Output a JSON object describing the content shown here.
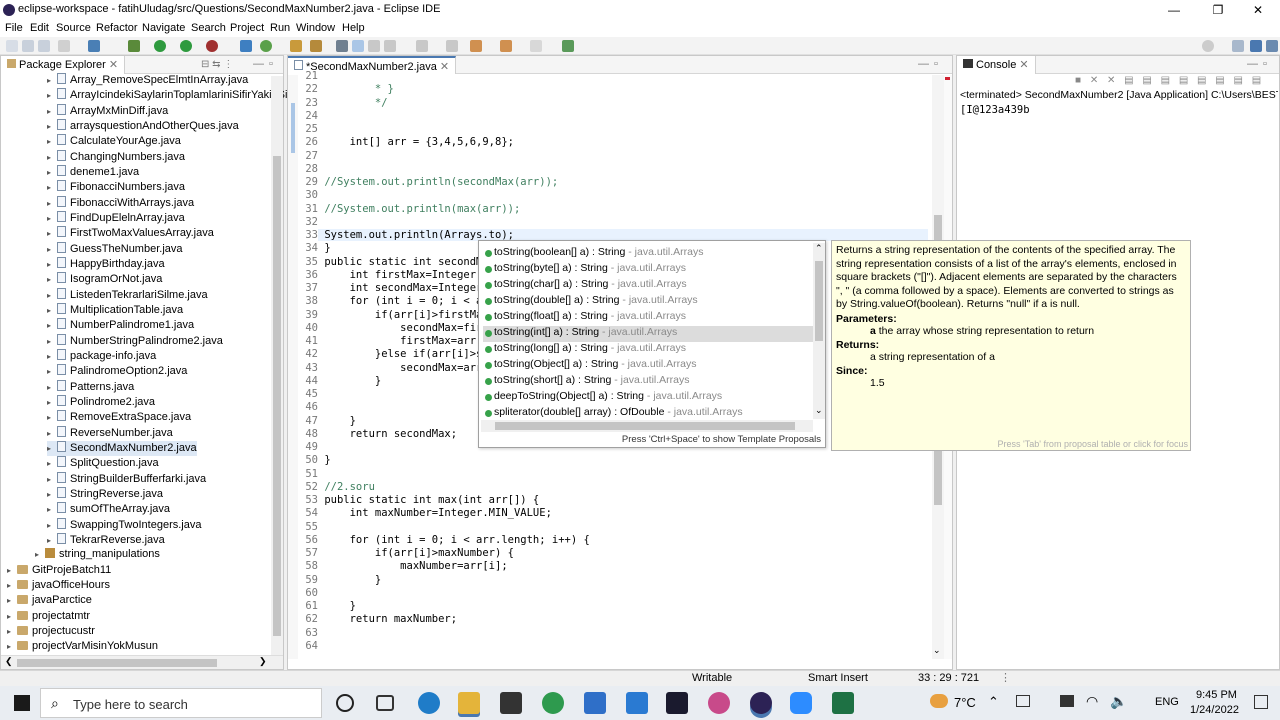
{
  "window": {
    "title": "eclipse-workspace - fatihUludag/src/Questions/SecondMaxNumber2.java - Eclipse IDE"
  },
  "menu": [
    "File",
    "Edit",
    "Source",
    "Refactor",
    "Navigate",
    "Search",
    "Project",
    "Run",
    "Window",
    "Help"
  ],
  "package_explorer": {
    "title": "Package Explorer",
    "files": [
      "Array_RemoveSpecElmtInArray.java",
      "ArrayIcindekiSaylarinToplamlariniSifirYakinSi",
      "ArrayMxMinDiff.java",
      "arraysquestionAndOtherQues.java",
      "CalculateYourAge.java",
      "ChangingNumbers.java",
      "deneme1.java",
      "FibonacciNumbers.java",
      "FibonacciWithArrays.java",
      "FindDupElelnArray.java",
      "FirstTwoMaxValuesArray.java",
      "GuessTheNumber.java",
      "HappyBirthday.java",
      "IsogramOrNot.java",
      "ListedenTekrarlariSilme.java",
      "MultiplicationTable.java",
      "NumberPalindrome1.java",
      "NumberStringPalindrome2.java",
      "package-info.java",
      "PalindromeOption2.java",
      "Patterns.java",
      "Polindrome2.java",
      "RemoveExtraSpace.java",
      "ReverseNumber.java",
      "SecondMaxNumber2.java",
      "SplitQuestion.java",
      "StringBuilderBufferfarki.java",
      "StringReverse.java",
      "sumOfTheArray.java",
      "SwappingTwoIntegers.java",
      "TekrarReverse.java"
    ],
    "package": "string_manipulations",
    "projects": [
      "GitProjeBatch11",
      "javaOfficeHours",
      "javaParctice",
      "projectatmtr",
      "projectucustr",
      "projectVarMisinYokMusun"
    ]
  },
  "editor": {
    "tab": "*SecondMaxNumber2.java",
    "lines": [
      {
        "n": "21",
        "t": ""
      },
      {
        "n": "22",
        "t": "         * }"
      },
      {
        "n": "23",
        "t": "         */"
      },
      {
        "n": "24",
        "t": ""
      },
      {
        "n": "25",
        "t": ""
      },
      {
        "n": "26",
        "t": "     int[] arr = {3,4,5,6,9,8};"
      },
      {
        "n": "27",
        "t": ""
      },
      {
        "n": "28",
        "t": ""
      },
      {
        "n": "29",
        "t": " //System.out.println(secondMax(arr));"
      },
      {
        "n": "30",
        "t": ""
      },
      {
        "n": "31",
        "t": " //System.out.println(max(arr));"
      },
      {
        "n": "32",
        "t": ""
      },
      {
        "n": "33",
        "t": " System.out.println(Arrays.to);"
      },
      {
        "n": "34",
        "t": " }"
      },
      {
        "n": "35",
        "t": " public static int secondMax"
      },
      {
        "n": "36",
        "t": "     int firstMax=Integer.MI"
      },
      {
        "n": "37",
        "t": "     int secondMax=Integer.M"
      },
      {
        "n": "38",
        "t": "     for (int i = 0; i < arr"
      },
      {
        "n": "39",
        "t": "         if(arr[i]>firstMax)"
      },
      {
        "n": "40",
        "t": "             secondMax=first"
      },
      {
        "n": "41",
        "t": "             firstMax=arr[i]"
      },
      {
        "n": "42",
        "t": "         }else if(arr[i]>sec"
      },
      {
        "n": "43",
        "t": "             secondMax=arr[i"
      },
      {
        "n": "44",
        "t": "         }"
      },
      {
        "n": "45",
        "t": ""
      },
      {
        "n": "46",
        "t": ""
      },
      {
        "n": "47",
        "t": "     }"
      },
      {
        "n": "48",
        "t": "     return secondMax;"
      },
      {
        "n": "49",
        "t": ""
      },
      {
        "n": "50",
        "t": " }"
      },
      {
        "n": "51",
        "t": ""
      },
      {
        "n": "52",
        "t": " //2.soru"
      },
      {
        "n": "53",
        "t": " public static int max(int arr[]) {"
      },
      {
        "n": "54",
        "t": "     int maxNumber=Integer.MIN_VALUE;"
      },
      {
        "n": "55",
        "t": ""
      },
      {
        "n": "56",
        "t": "     for (int i = 0; i < arr.length; i++) {"
      },
      {
        "n": "57",
        "t": "         if(arr[i]>maxNumber) {"
      },
      {
        "n": "58",
        "t": "             maxNumber=arr[i];"
      },
      {
        "n": "59",
        "t": "         }"
      },
      {
        "n": "60",
        "t": ""
      },
      {
        "n": "61",
        "t": "     }"
      },
      {
        "n": "62",
        "t": "     return maxNumber;"
      },
      {
        "n": "63",
        "t": ""
      },
      {
        "n": "64",
        "t": ""
      }
    ]
  },
  "completion": {
    "proposals": [
      {
        "main": "toString(boolean[] a) : String",
        "pkg": " - java.util.Arrays"
      },
      {
        "main": "toString(byte[] a) : String",
        "pkg": " - java.util.Arrays"
      },
      {
        "main": "toString(char[] a) : String",
        "pkg": " - java.util.Arrays"
      },
      {
        "main": "toString(double[] a) : String",
        "pkg": " - java.util.Arrays"
      },
      {
        "main": "toString(float[] a) : String",
        "pkg": " - java.util.Arrays"
      },
      {
        "main": "toString(int[] a) : String",
        "pkg": " - java.util.Arrays"
      },
      {
        "main": "toString(long[] a) : String",
        "pkg": " - java.util.Arrays"
      },
      {
        "main": "toString(Object[] a) : String",
        "pkg": " - java.util.Arrays"
      },
      {
        "main": "toString(short[] a) : String",
        "pkg": " - java.util.Arrays"
      },
      {
        "main": "deepToString(Object[] a) : String",
        "pkg": " - java.util.Arrays"
      },
      {
        "main": "spliterator(double[] array) : OfDouble",
        "pkg": " - java.util.Arrays"
      }
    ],
    "selected_index": 5,
    "footer": "Press 'Ctrl+Space' to show Template Proposals"
  },
  "javadoc": {
    "desc1": "Returns a string representation of the contents of the specified array. The string representation consists of a list of the array's elements, enclosed in square brackets (\"[]\"). Adjacent elements are separated by the characters \", \" (a comma followed by a space). Elements are converted to strings as by String.valueOf(boolean). Returns \"null\" if a is null.",
    "params_label": "Parameters:",
    "param_name": "a",
    "param_desc": " the array whose string representation to return",
    "returns_label": "Returns:",
    "returns_desc": "a string representation of a",
    "since_label": "Since:",
    "since_val": "1.5",
    "footer": "Press 'Tab' from proposal table or click for focus"
  },
  "console": {
    "title": "Console",
    "header": "<terminated> SecondMaxNumber2 [Java Application] C:\\Users\\BEST TE",
    "output": "[I@123a439b"
  },
  "status": {
    "writable": "Writable",
    "insert": "Smart Insert",
    "position": "33 : 29 : 721"
  },
  "taskbar": {
    "search_placeholder": "Type here to search",
    "temp": "7°C",
    "lang": "ENG",
    "time": "9:45 PM",
    "date": "1/24/2022"
  }
}
